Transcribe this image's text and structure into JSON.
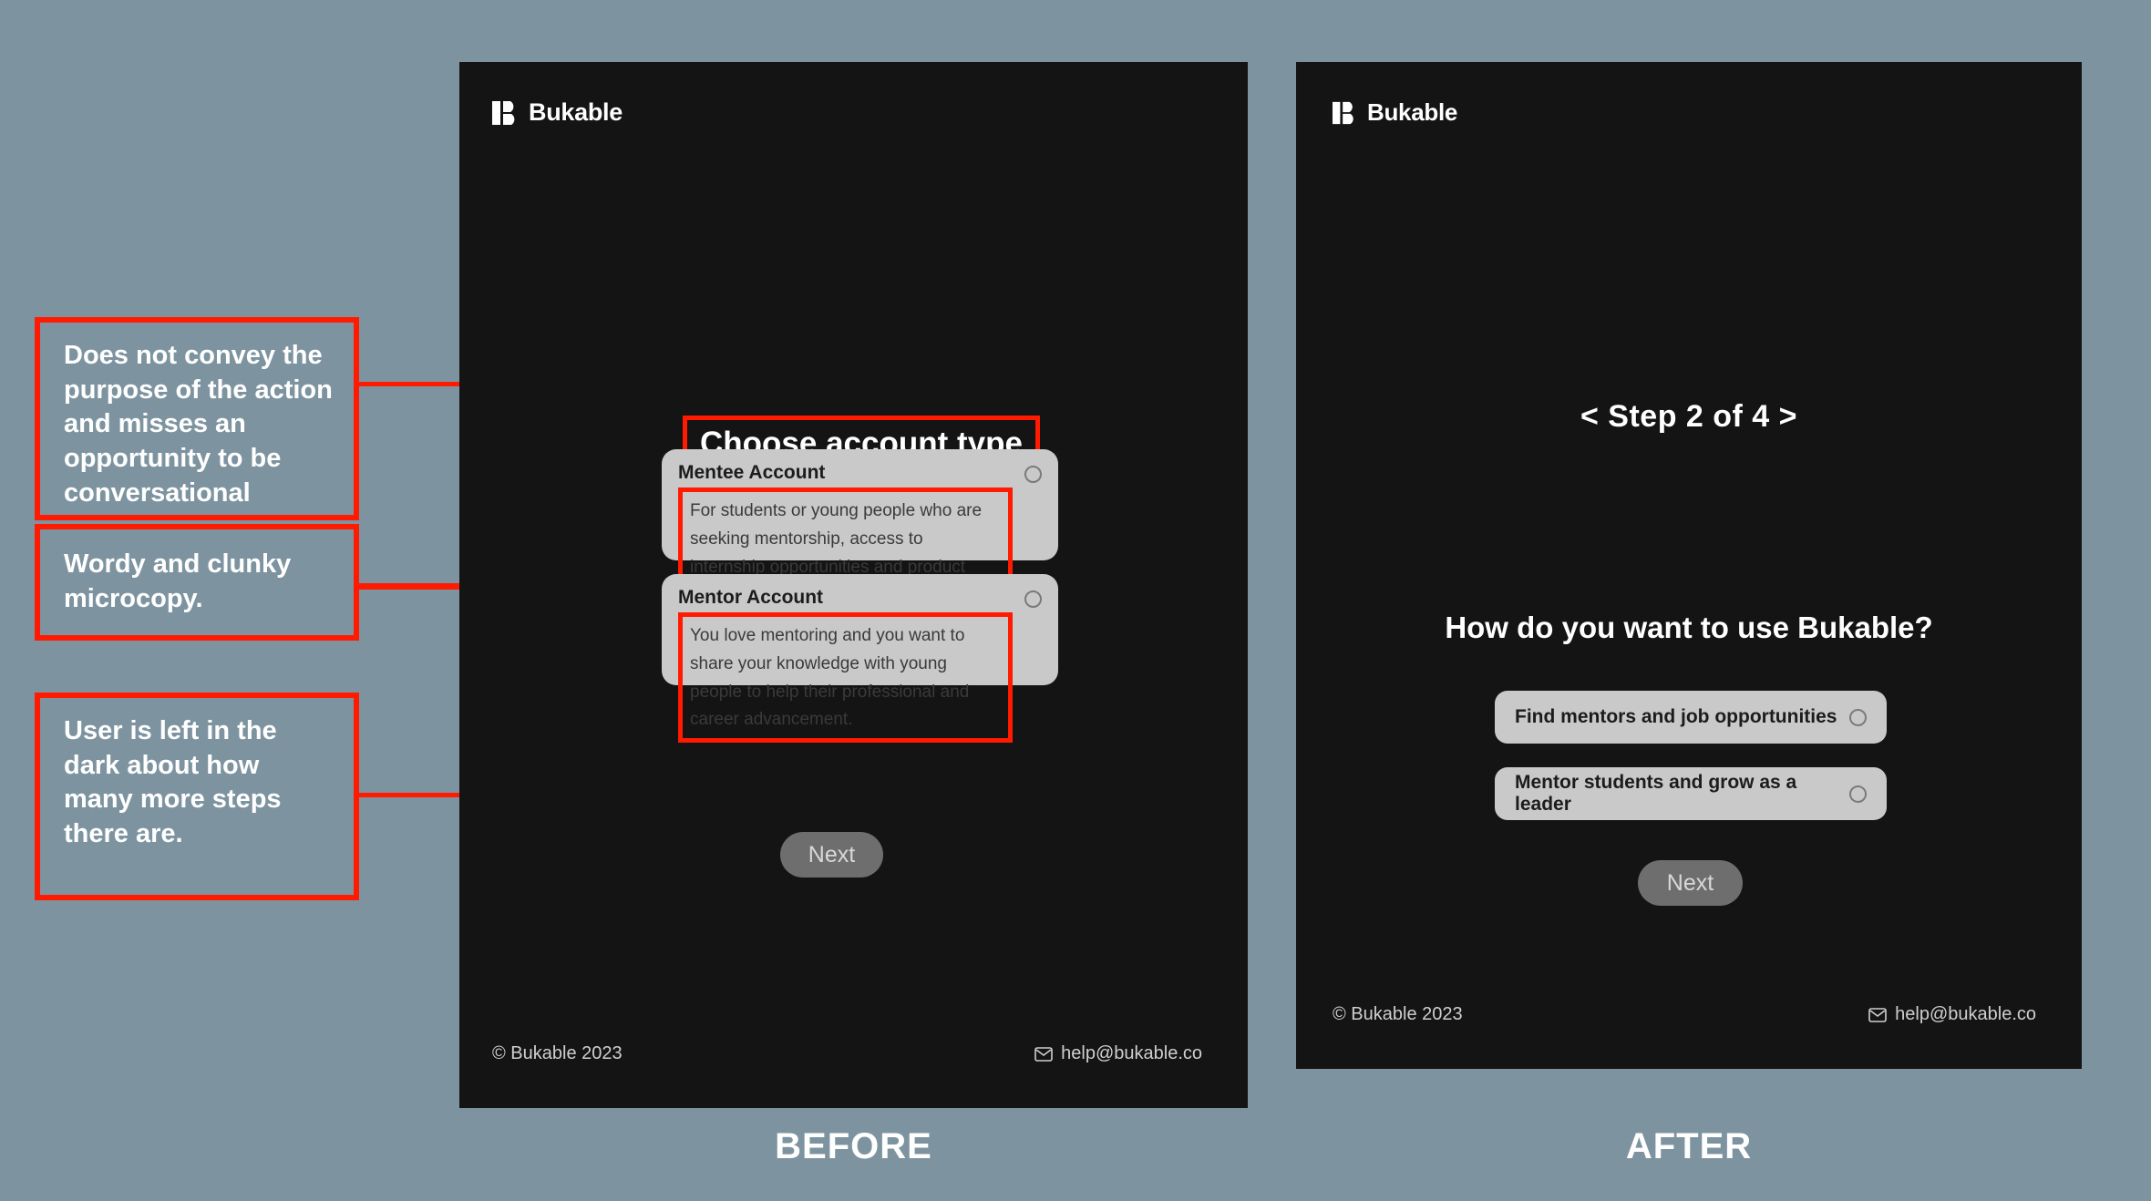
{
  "canvas": {
    "background_color": "#7d94a0",
    "panel_color": "#141414",
    "annotation_color": "#ff1a00"
  },
  "annotations": [
    {
      "id": "a1",
      "text": "Does not convey the purpose of the action and misses an opportunity to be conversational"
    },
    {
      "id": "a2",
      "text": "Wordy and clunky microcopy."
    },
    {
      "id": "a3",
      "text": "User is left in the dark about how many more steps there are."
    }
  ],
  "before": {
    "caption": "BEFORE",
    "logo": {
      "word": "Bukable",
      "mark": "bukable-b-logo"
    },
    "title": "Choose account type",
    "cards": [
      {
        "title": "Mentee Account",
        "description": "For students or young people who are seeking mentorship, access to internship opportunities and product deals from companies.",
        "radio": "unselected"
      },
      {
        "title": "Mentor Account",
        "description": "You love mentoring and you want to share your knowledge with young people to help their professional and career advancement.",
        "radio": "unselected"
      }
    ],
    "next_label": "Next",
    "footer": {
      "copyright": "© Bukable 2023",
      "email": "help@bukable.co",
      "email_icon": "envelope-icon"
    }
  },
  "after": {
    "caption": "AFTER",
    "logo": {
      "word": "Bukable",
      "mark": "bukable-b-logo"
    },
    "step_indicator": "< Step 2 of 4 >",
    "step_prev": "<",
    "step_current": 2,
    "step_total": 4,
    "step_next": ">",
    "heading": "How do you want to use Bukable?",
    "options": [
      {
        "label": "Find mentors and job opportunities",
        "radio": "unselected"
      },
      {
        "label": "Mentor students and grow as a leader",
        "radio": "unselected"
      }
    ],
    "next_label": "Next",
    "footer": {
      "copyright": "© Bukable 2023",
      "email": "help@bukable.co",
      "email_icon": "envelope-icon"
    }
  }
}
